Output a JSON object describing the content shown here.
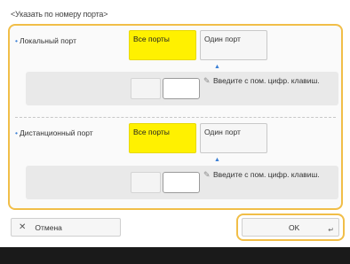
{
  "title": "<Указать по номеру порта>",
  "local": {
    "label": "Локальный порт",
    "all_ports": "Все порты",
    "one_port": "Один порт",
    "hint": "Введите с пом. цифр. клавиш."
  },
  "remote": {
    "label": "Дистанционный порт",
    "all_ports": "Все порты",
    "one_port": "Один порт",
    "hint": "Введите с пом. цифр. клавиш."
  },
  "footer": {
    "cancel": "Отмена",
    "ok": "OK"
  },
  "colors": {
    "selected": "#fff100",
    "focus_border": "#f1be48",
    "bullet": "#3a7fd5"
  }
}
